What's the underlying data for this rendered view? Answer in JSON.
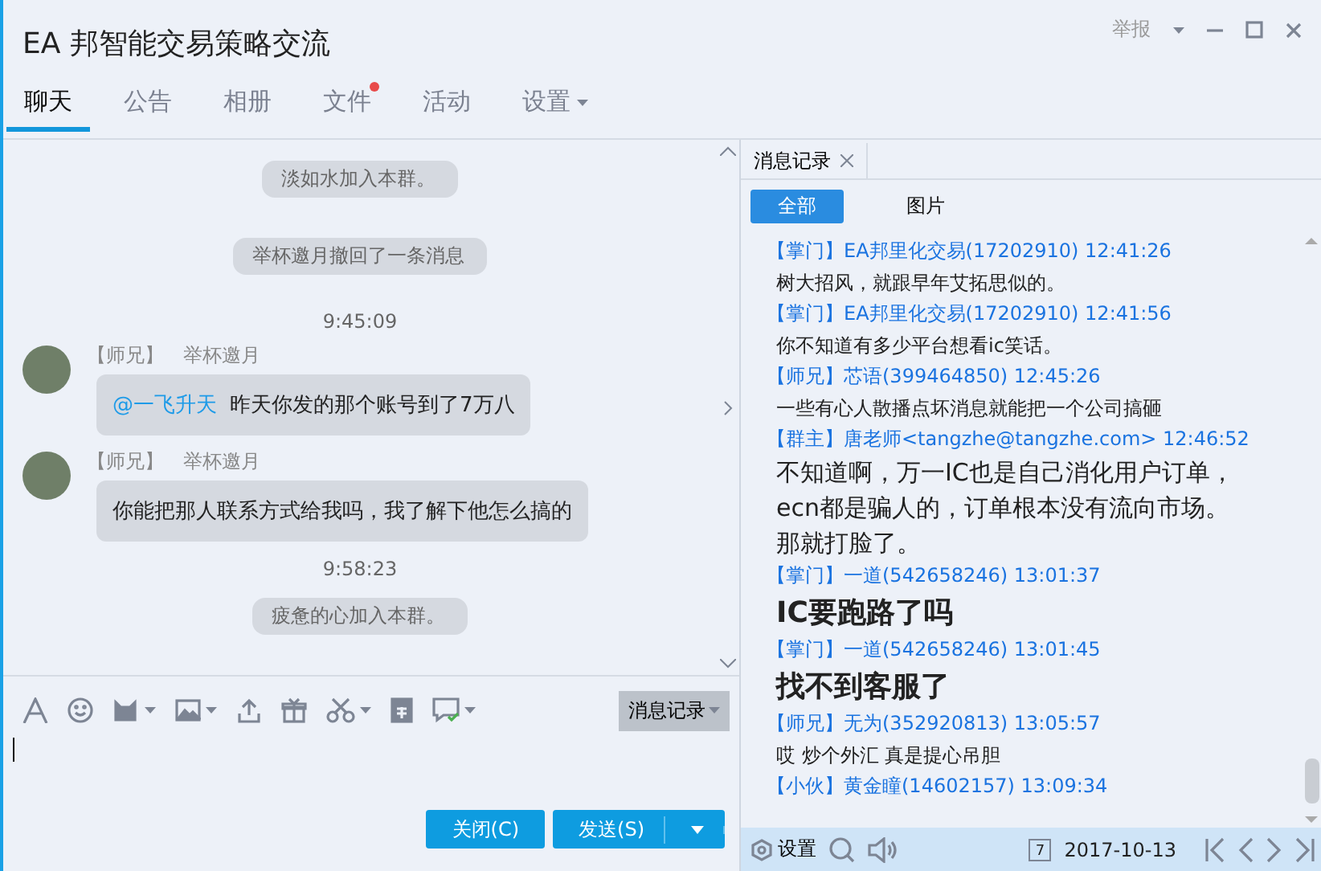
{
  "window": {
    "title": "EA 邦智能交易策略交流",
    "report": "举报"
  },
  "tabs": [
    {
      "label": "聊天",
      "selected": true,
      "badge": false,
      "has_menu": false
    },
    {
      "label": "公告",
      "selected": false,
      "badge": false,
      "has_menu": false
    },
    {
      "label": "相册",
      "selected": false,
      "badge": false,
      "has_menu": false
    },
    {
      "label": "文件",
      "selected": false,
      "badge": true,
      "has_menu": false
    },
    {
      "label": "活动",
      "selected": false,
      "badge": false,
      "has_menu": false
    },
    {
      "label": "设置",
      "selected": false,
      "badge": false,
      "has_menu": true
    }
  ],
  "chat": {
    "messages": [
      {
        "kind": "notice",
        "text": "淡如水加入本群。"
      },
      {
        "kind": "notice",
        "text": "举杯邀月撤回了一条消息"
      },
      {
        "kind": "time",
        "text": "9:45:09"
      },
      {
        "kind": "message",
        "role": "【师兄】",
        "sender": "举杯邀月",
        "mention": "@一飞升天",
        "text": "昨天你发的那个账号到了7万八"
      },
      {
        "kind": "message",
        "role": "【师兄】",
        "sender": "举杯邀月",
        "text": "你能把那人联系方式给我吗，我了解下他怎么搞的"
      },
      {
        "kind": "time",
        "text": "9:58:23"
      },
      {
        "kind": "notice",
        "text": "疲惫的心加入本群。"
      }
    ]
  },
  "composer": {
    "history_button": "消息记录",
    "close_button": "关闭(C)",
    "send_button": "发送(S)"
  },
  "history": {
    "tab": "消息记录",
    "filters": [
      {
        "label": "全部",
        "selected": true
      },
      {
        "label": "图片",
        "selected": false
      }
    ],
    "entries": [
      {
        "kind": "normal",
        "header": "【掌门】EA邦里化交易(17202910) 12:41:26",
        "text": "树大招风，就跟早年艾拓思似的。"
      },
      {
        "kind": "normal",
        "header": "【掌门】EA邦里化交易(17202910) 12:41:56",
        "text": "你不知道有多少平台想看ic笑话。"
      },
      {
        "kind": "normal",
        "header": "【师兄】芯语(399464850) 12:45:26",
        "text": "一些有心人散播点坏消息就能把一个公司搞砸"
      },
      {
        "kind": "large",
        "header": "【群主】唐老师<tangzhe@tangzhe.com> 12:46:52",
        "text": "不知道啊，万一IC也是自己消化用户订单，ecn都是骗人的，订单根本没有流向市场。那就打脸了。"
      },
      {
        "kind": "bold",
        "header": "【掌门】一道(542658246) 13:01:37",
        "text": "IC要跑路了吗"
      },
      {
        "kind": "bold",
        "header": "【掌门】一道(542658246) 13:01:45",
        "text": "找不到客服了"
      },
      {
        "kind": "normal",
        "header": "【师兄】无为(352920813) 13:05:57",
        "text": "哎  炒个外汇 真是提心吊胆"
      },
      {
        "kind": "normal",
        "header": "【小伙】黄金瞳(14602157) 13:09:34"
      }
    ],
    "footer": {
      "settings": "设置",
      "calendar_day": "7",
      "date": "2017-10-13"
    }
  }
}
